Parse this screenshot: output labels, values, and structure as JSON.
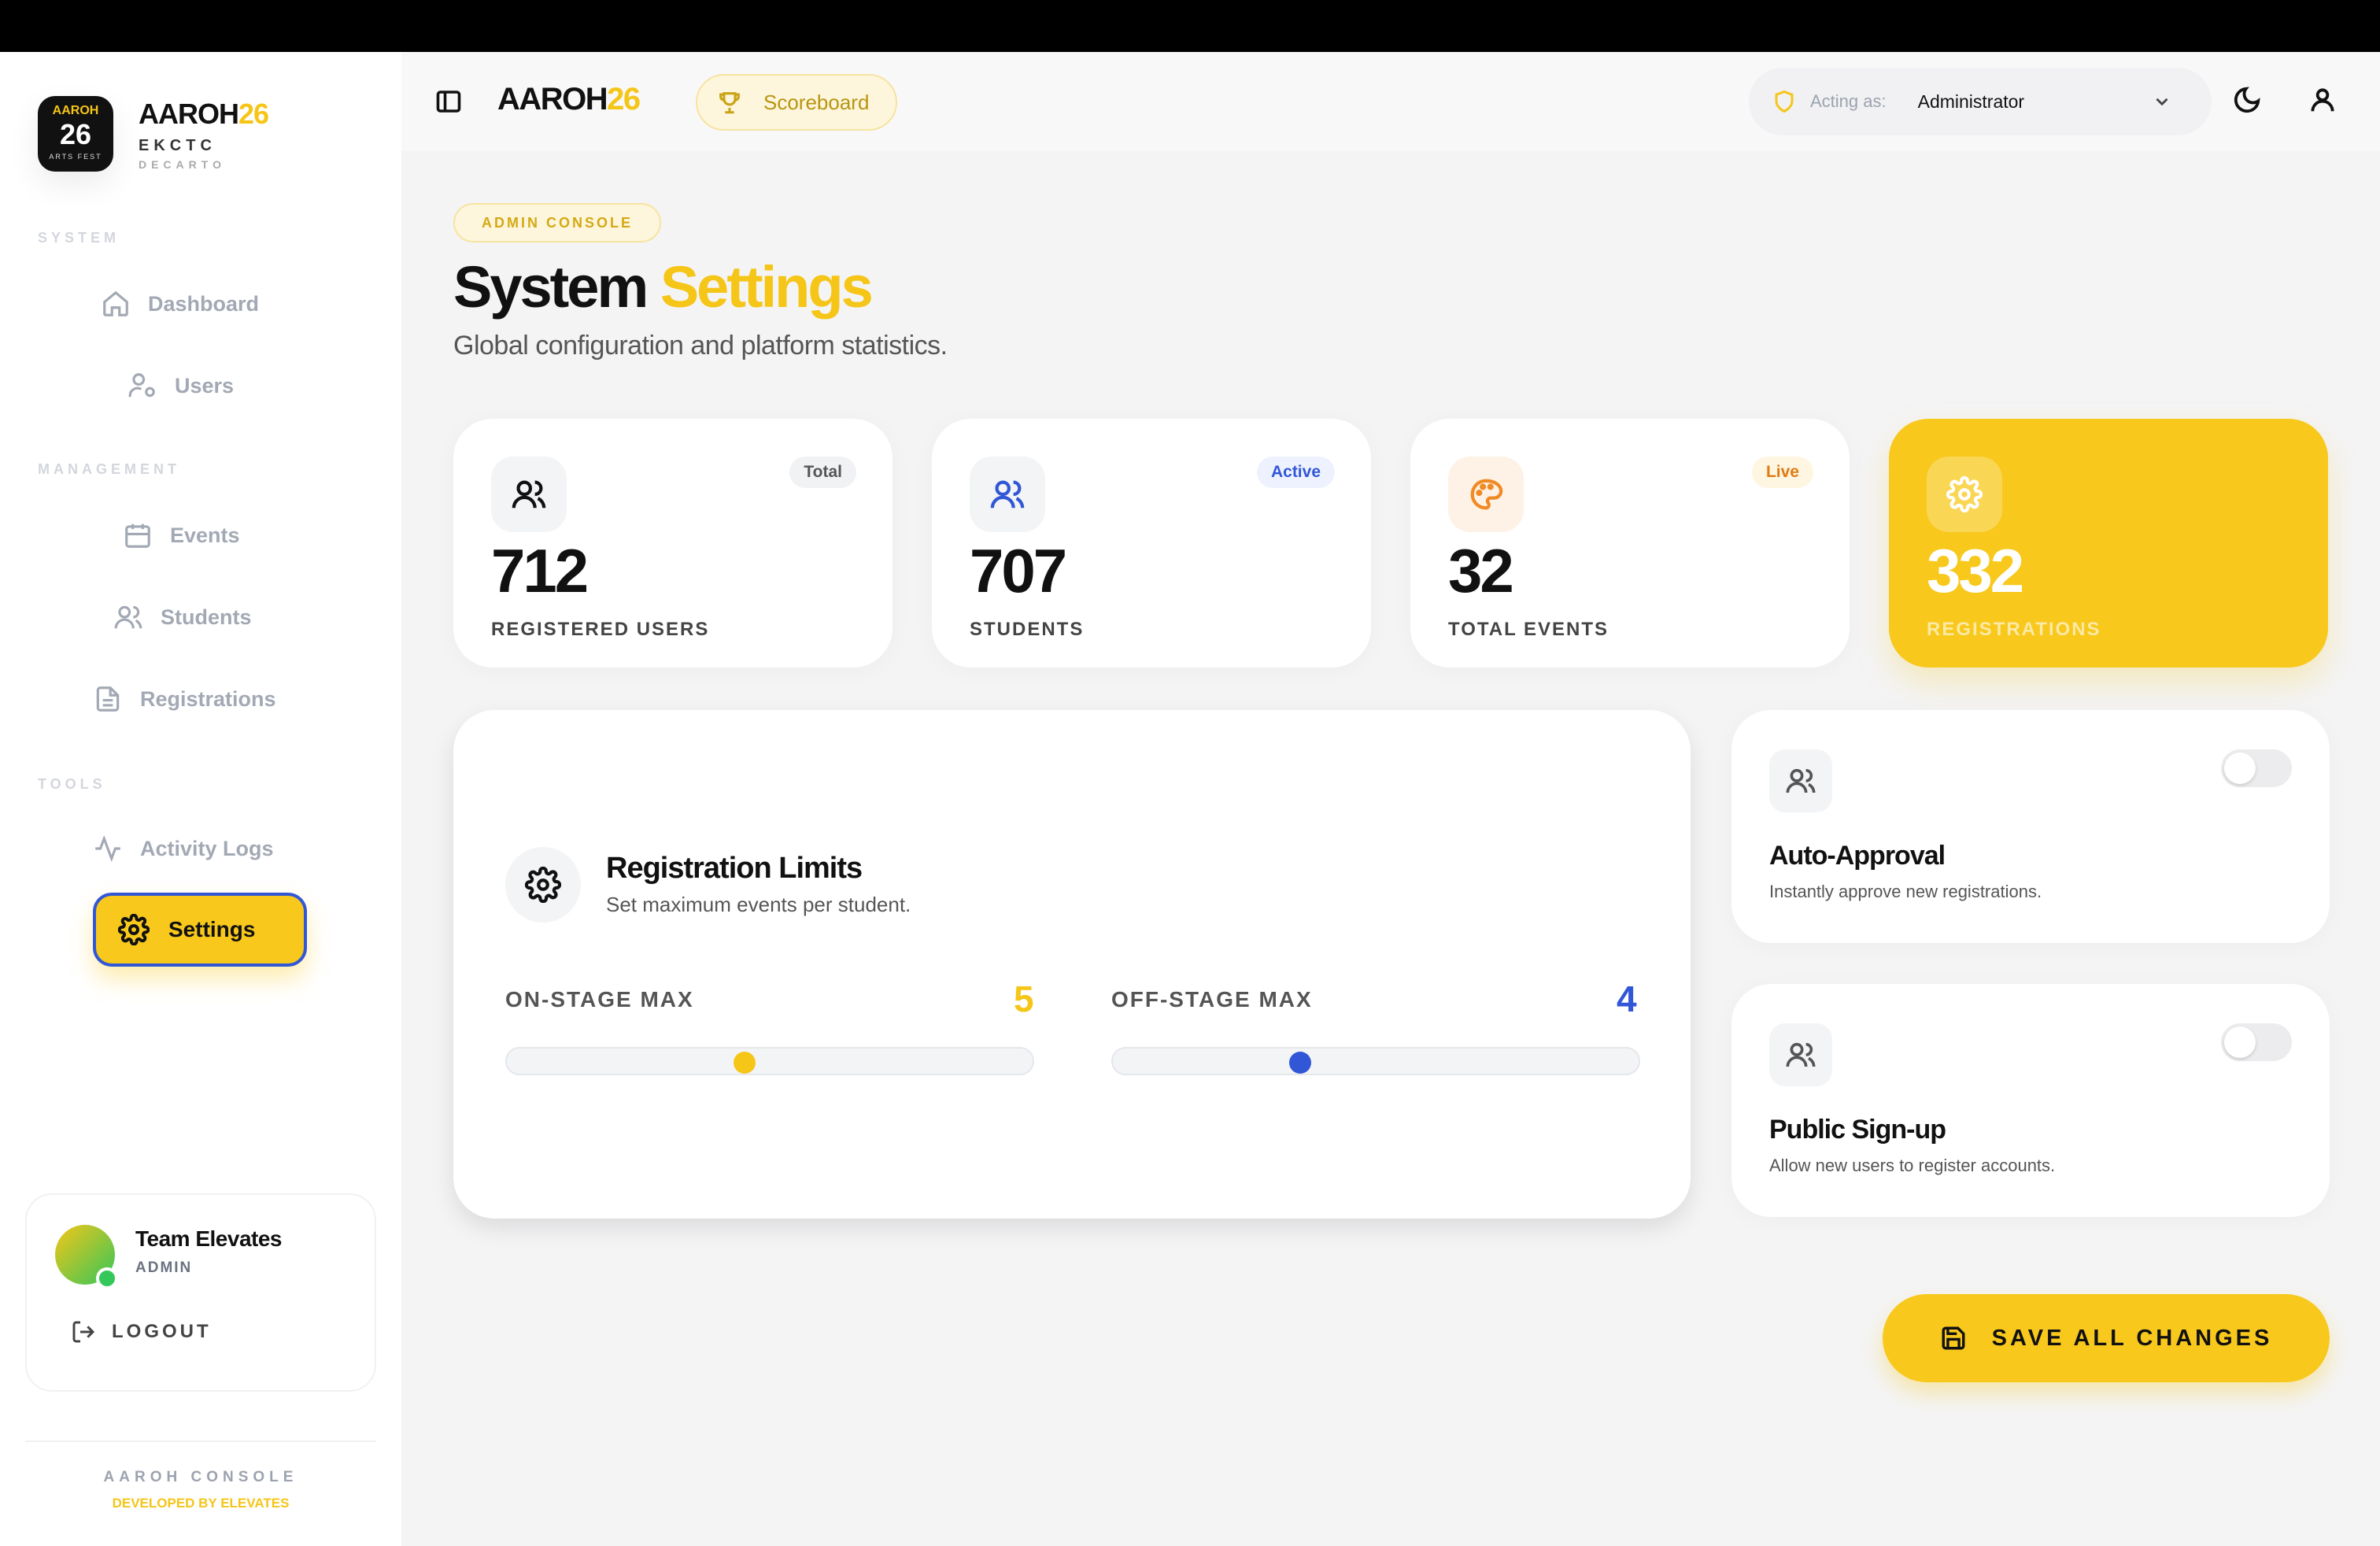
{
  "brand": {
    "logo_top": "AAROH",
    "logo_num": "26",
    "logo_bottom": "ARTS FEST",
    "name": "AAROH",
    "name_num": "26",
    "sub1": "EKCTC",
    "sub2": "DECARTO"
  },
  "sidebar": {
    "sections": {
      "system": "SYSTEM",
      "management": "MANAGEMENT",
      "tools": "TOOLS"
    },
    "items": {
      "dashboard": "Dashboard",
      "users": "Users",
      "events": "Events",
      "students": "Students",
      "registrations": "Registrations",
      "activity_logs": "Activity Logs",
      "settings": "Settings"
    },
    "active_item": "settings"
  },
  "user": {
    "name": "Team Elevates",
    "role": "ADMIN",
    "logout_label": "LOGOUT"
  },
  "footer": {
    "title": "AAROH CONSOLE",
    "credit": "DEVELOPED BY ELEVATES"
  },
  "header": {
    "brand": "AAROH",
    "brand_num": "26",
    "scoreboard_label": "Scoreboard",
    "acting_label": "Acting as:",
    "acting_value": "Administrator"
  },
  "page": {
    "badge": "ADMIN CONSOLE",
    "title_a": "System",
    "title_b": "Settings",
    "subtitle": "Global configuration and platform statistics."
  },
  "stats": [
    {
      "tag": "Total",
      "value": "712",
      "label": "REGISTERED USERS",
      "icon": "users-icon"
    },
    {
      "tag": "Active",
      "value": "707",
      "label": "STUDENTS",
      "icon": "users-icon"
    },
    {
      "tag": "Live",
      "value": "32",
      "label": "TOTAL EVENTS",
      "icon": "palette-icon"
    },
    {
      "value": "332",
      "label": "REGISTRATIONS",
      "icon": "gear-icon"
    }
  ],
  "limits": {
    "title": "Registration Limits",
    "subtitle": "Set maximum events per student.",
    "on_stage_label": "ON-STAGE MAX",
    "on_stage_value": "5",
    "on_stage_fraction": 0.45,
    "off_stage_label": "OFF-STAGE MAX",
    "off_stage_value": "4",
    "off_stage_fraction": 0.35
  },
  "toggles": [
    {
      "title": "Auto-Approval",
      "desc": "Instantly approve new registrations.",
      "on": false
    },
    {
      "title": "Public Sign-up",
      "desc": "Allow new users to register accounts.",
      "on": false
    }
  ],
  "save_label": "SAVE ALL CHANGES",
  "colors": {
    "accent": "#f8c81c",
    "blue": "#3157d6",
    "orange": "#f08a24"
  }
}
